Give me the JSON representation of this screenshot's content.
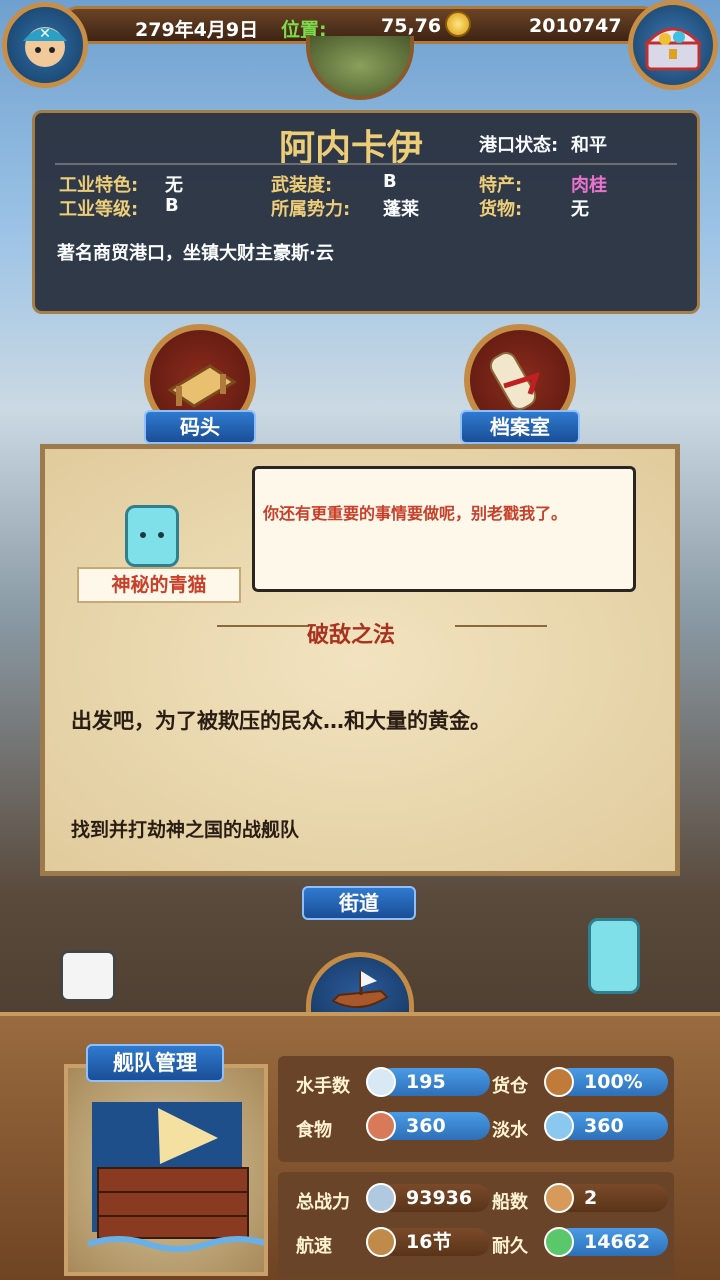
{
  "header": {
    "date": "279年4月9日",
    "location_label": "位置:",
    "coordinates": "75,76",
    "gold": "2010747",
    "avatar_icon": "pirate-avatar-icon",
    "coin_icon": "gold-coin-icon",
    "chest_icon": "treasure-chest-icon"
  },
  "port": {
    "name": "阿内卡伊",
    "status_label": "港口状态:",
    "status_value": "和平",
    "rows": [
      {
        "k1": "工业特色:",
        "v1": "无",
        "k2": "武装度:",
        "v2": "B",
        "k3": "特产:",
        "v3": "肉桂"
      },
      {
        "k1": "工业等级:",
        "v1": "B",
        "k2": "所属势力:",
        "v2": "蓬莱",
        "k3": "货物:",
        "v3": "无"
      }
    ],
    "description": "著名商贸港口，坐镇大财主豪斯·云"
  },
  "buttons": {
    "dock": "码头",
    "archive": "档案室",
    "street": "街道"
  },
  "dialog": {
    "speaker": "神秘的青猫",
    "speech": "你还有更重要的事情要做呢，别老戳我了。",
    "section_title": "破敌之法",
    "body": "出发吧，为了被欺压的民众…和大量的黄金。",
    "objective": "找到并打劫神之国的战舰队"
  },
  "fleet": {
    "title": "舰队管理",
    "stats_top": [
      {
        "label": "水手数",
        "value": "195",
        "icon": "sailor-icon"
      },
      {
        "label": "货仓",
        "value": "100%",
        "icon": "cargo-crate-icon"
      },
      {
        "label": "食物",
        "value": "360",
        "icon": "meat-icon"
      },
      {
        "label": "淡水",
        "value": "360",
        "icon": "water-jug-icon"
      }
    ],
    "stats_bottom": [
      {
        "label": "总战力",
        "value": "93936",
        "icon": "crossed-swords-icon"
      },
      {
        "label": "船数",
        "value": "2",
        "icon": "ship-count-icon"
      },
      {
        "label": "航速",
        "value": "16节",
        "icon": "ship-speed-icon"
      },
      {
        "label": "耐久",
        "value": "14662",
        "icon": "durability-icon"
      }
    ]
  },
  "colors": {
    "accent_gold": "#f3cf73",
    "specialty_pink": "#f06fd0",
    "dialog_red": "#c8402a",
    "panel_blue": "#2e6fb8"
  }
}
